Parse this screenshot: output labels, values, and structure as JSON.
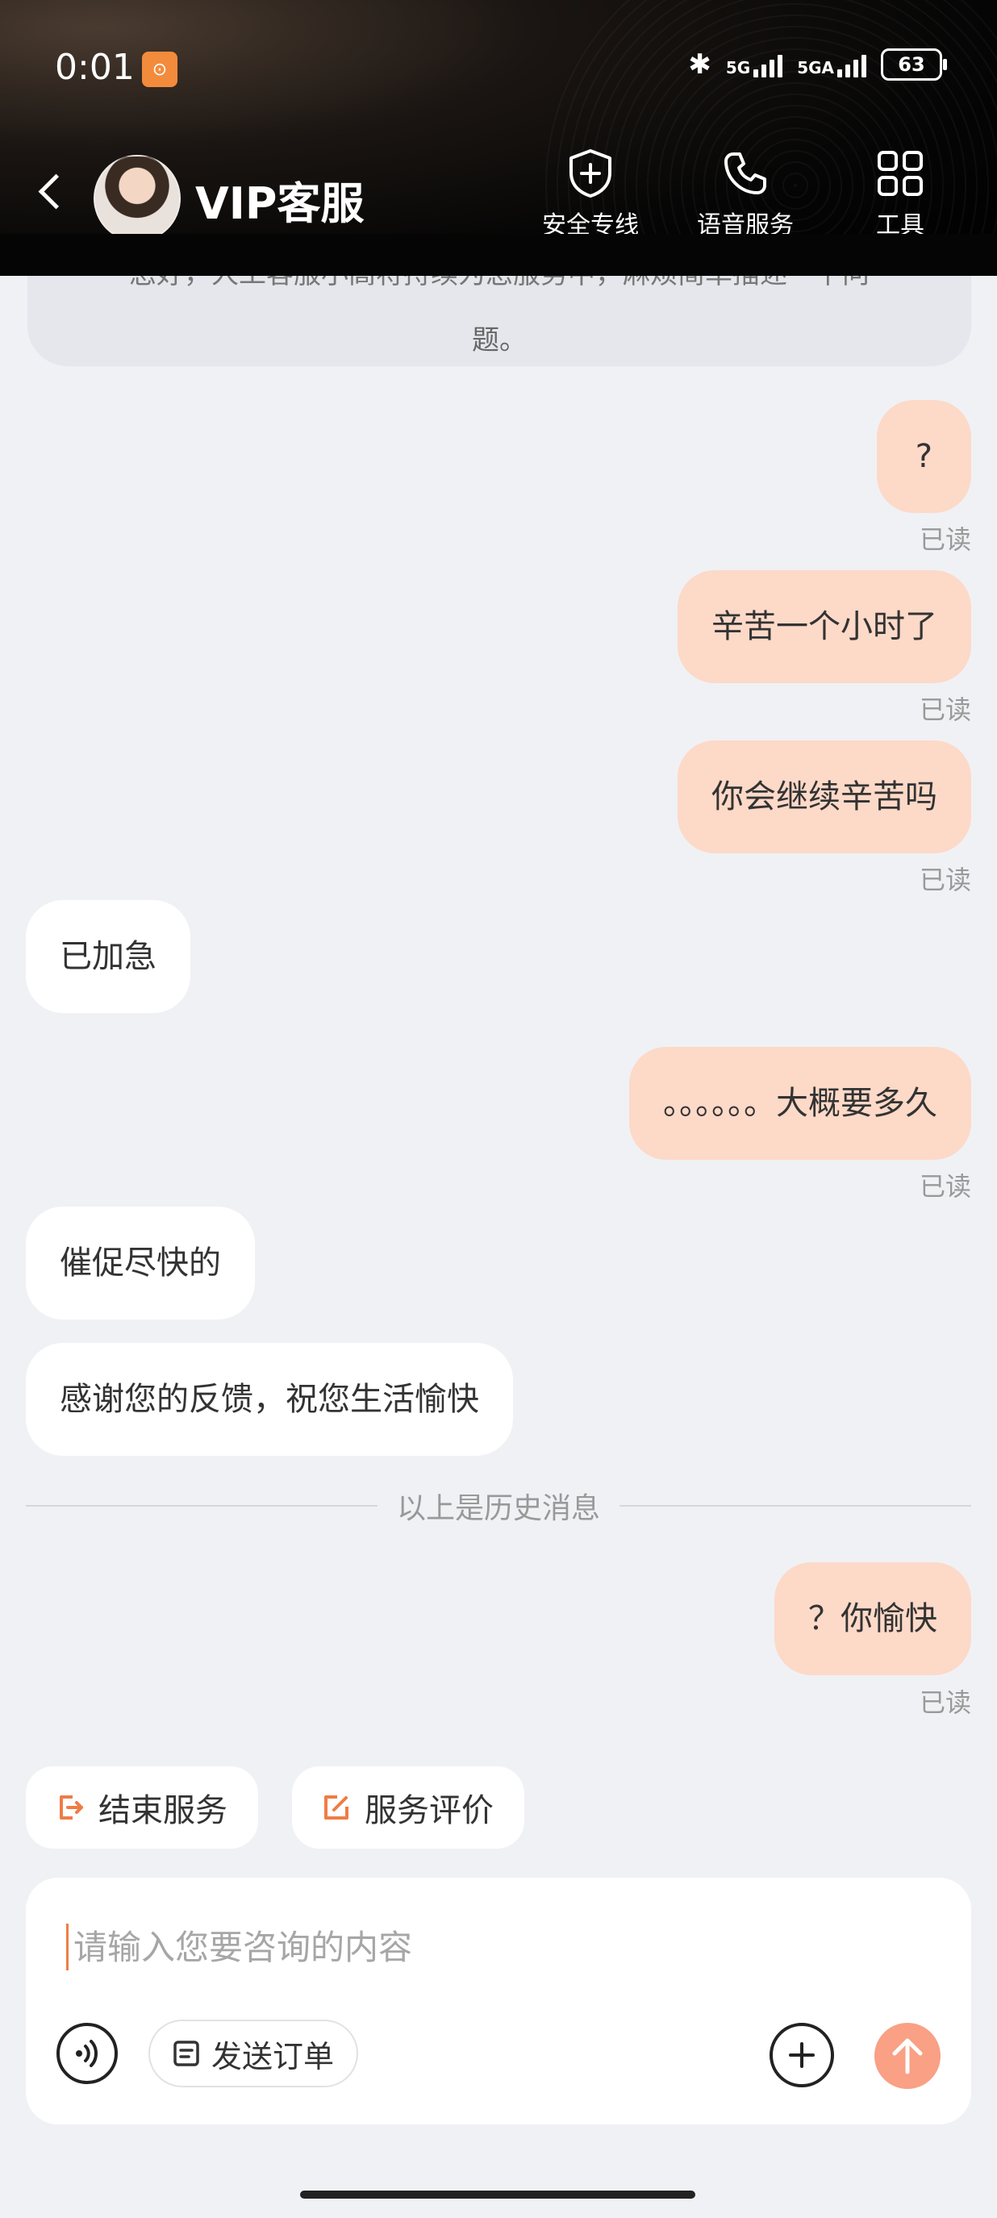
{
  "status_bar": {
    "time": "0:01",
    "signal1": "5G",
    "signal2": "5GA",
    "battery": "63"
  },
  "nav": {
    "title": "VIP客服",
    "actions": [
      {
        "label": "安全专线",
        "icon": "shield-plus-icon"
      },
      {
        "label": "语音服务",
        "icon": "phone-icon"
      },
      {
        "label": "工具",
        "icon": "grid-icon"
      }
    ]
  },
  "notice": {
    "line1": "您好，人工客服小高将持续为您服务中，麻烦简单描述一下问",
    "line2": "题。"
  },
  "messages": [
    {
      "side": "mine",
      "text": "?",
      "read": "已读"
    },
    {
      "side": "mine",
      "text": "辛苦一个小时了",
      "read": "已读"
    },
    {
      "side": "mine",
      "text": "你会继续辛苦吗",
      "read": "已读"
    },
    {
      "side": "theirs",
      "text": "已加急"
    },
    {
      "side": "mine",
      "text": "。。。。。。大概要多久",
      "read": "已读"
    },
    {
      "side": "theirs",
      "text": "催促尽快的"
    },
    {
      "side": "theirs",
      "text": "感谢您的反馈，祝您生活愉快"
    },
    {
      "side": "mine",
      "text": "？你愉快",
      "read": "已读"
    }
  ],
  "divider": "以上是历史消息",
  "quick_actions": {
    "end_service": "结束服务",
    "rate_service": "服务评价"
  },
  "input": {
    "placeholder": "请输入您要咨询的内容",
    "send_order": "发送订单"
  },
  "colors": {
    "accent": "#f07c45",
    "mine_bubble": "#fdd9c8",
    "send_button": "#f9a085"
  }
}
